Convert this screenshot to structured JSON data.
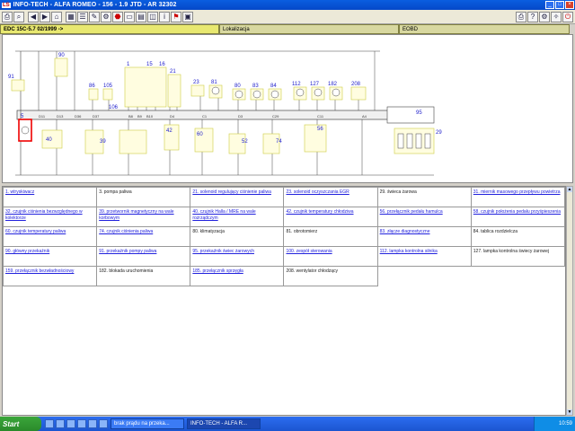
{
  "app": {
    "logo": "LS",
    "title": "INFO-TECH - ALFA ROMEO - 156 - 1.9 JTD - AR 32302"
  },
  "toolbar": {
    "left_icons": [
      "printer-icon",
      "zoom-icon",
      "back-icon",
      "forward-icon",
      "home-icon",
      "grid-icon",
      "list-icon",
      "pencil-icon",
      "wrench-icon",
      "stop-icon",
      "open-icon",
      "chart-icon",
      "photo-icon",
      "info-icon",
      "flag-icon",
      "film-icon"
    ],
    "right_icons": [
      "print-icon",
      "help-icon",
      "settings-icon",
      "tools-icon",
      "exit-icon"
    ]
  },
  "tabs": [
    {
      "label": "EDC 15C-5.7 02/1999 ->",
      "active": true
    },
    {
      "label": "Lokalizacja",
      "active": false
    },
    {
      "label": "EOBD",
      "active": false
    }
  ],
  "diagram": {
    "top_labels": [
      "91",
      "90",
      "86",
      "105",
      "1",
      "15",
      "16",
      "106",
      "21",
      "23",
      "81",
      "80",
      "83",
      "84",
      "112",
      "127",
      "182",
      "208",
      "95",
      "56",
      "40",
      "39",
      "42",
      "60",
      "52",
      "74",
      "29",
      "5"
    ]
  },
  "components": [
    [
      "1. wtryskiwacz",
      "3. pompa paliwa",
      "21. solenoid regulujący ciśnienie paliwa",
      "23. solenoid oczyszczania EGR",
      "29. świeca żarowa",
      "31. miernik masowego przepływu powietrza"
    ],
    [
      "32. czujnik ciśnienia bezwzględnego w kolektorze",
      "39. przetwornik magnetyczny na wale korbowym",
      "40. czujnik Halla / MRE na wale rozrządczym",
      "42. czujnik temperatury chłodziwa",
      "56. przełącznik pedału hamulca",
      "58. czujnik położenia pedału przyśpieszenia"
    ],
    [
      "60. czujnik temperatury paliwa",
      "74. czujnik ciśnienia paliwa",
      "80. klimatyzacja",
      "81. obrotomierz",
      "83. złącze diagnostyczne",
      "84. tablica rozdzielcza"
    ],
    [
      "90. główny przekaźnik",
      "91. przekaźnik pompy paliwa",
      "95. przekaźnik świec żarowych",
      "100. zespół sterowania",
      "112. lampka kontrolna silnika",
      "127. lampka kontrolna świecy żarowej"
    ],
    [
      "159. przełącznik bezwładnościowy",
      "182. blokada uruchomienia",
      "185. przełącznik sprzęgła",
      "208. wentylator chłodzący",
      "",
      ""
    ]
  ],
  "taskbar": {
    "start": "Start",
    "tasks": [
      "brak prądu na przeka...",
      "INFO-TECH - ALFA R..."
    ],
    "clock": "10:59"
  }
}
